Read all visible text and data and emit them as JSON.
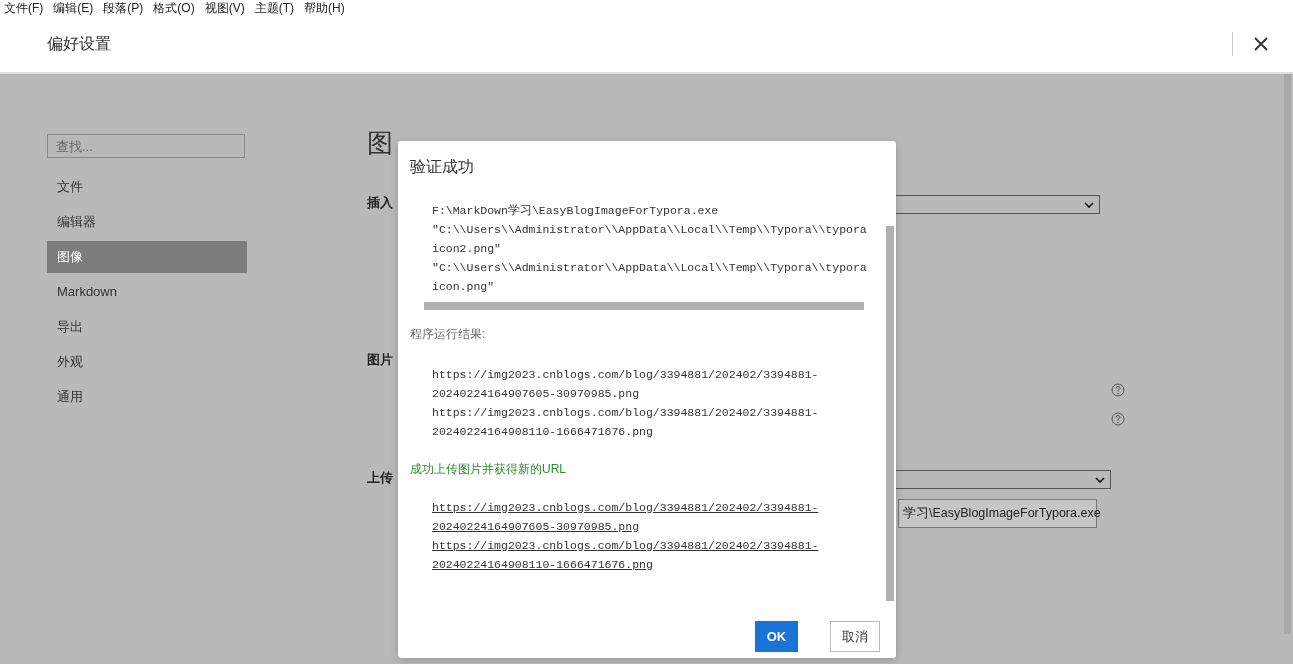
{
  "menu_bar": [
    "文件(F)",
    "编辑(E)",
    "段落(P)",
    "格式(O)",
    "视图(V)",
    "主题(T)",
    "帮助(H)"
  ],
  "window": {
    "title": "偏好设置"
  },
  "search": {
    "placeholder": "查找..."
  },
  "sidebar": {
    "items": [
      {
        "label": "文件",
        "selected": false
      },
      {
        "label": "编辑器",
        "selected": false
      },
      {
        "label": "图像",
        "selected": true
      },
      {
        "label": "Markdown",
        "selected": false
      },
      {
        "label": "导出",
        "selected": false
      },
      {
        "label": "外观",
        "selected": false
      },
      {
        "label": "通用",
        "selected": false
      }
    ]
  },
  "content": {
    "heading": "图",
    "section_labels": [
      "插入",
      "图片",
      "上传"
    ],
    "upload_command_button": "学习\\EasyBlogImageForTypora.exe"
  },
  "dialog": {
    "title": "验证成功",
    "command_lines": [
      "F:\\MarkDown学习\\EasyBlogImageForTypora.exe",
      "\"C:\\\\Users\\\\Administrator\\\\AppData\\\\Local\\\\Temp\\\\Typora\\\\typora",
      "icon2.png\"",
      "\"C:\\\\Users\\\\Administrator\\\\AppData\\\\Local\\\\Temp\\\\Typora\\\\typora",
      "icon.png\""
    ],
    "result_label": "程序运行结果:",
    "result_lines": [
      "https://img2023.cnblogs.com/blog/3394881/202402/3394881-",
      "20240224164907605-30970985.png",
      "https://img2023.cnblogs.com/blog/3394881/202402/3394881-",
      "20240224164908110-1666471676.png"
    ],
    "success_message": "成功上传图片并获得新的URL",
    "links": [
      "https://img2023.cnblogs.com/blog/3394881/202402/3394881-\n20240224164907605-30970985.png",
      "https://img2023.cnblogs.com/blog/3394881/202402/3394881-\n20240224164908110-1666471676.png"
    ],
    "buttons": [
      {
        "label": "OK",
        "kind": "primary"
      },
      {
        "label": "取消",
        "kind": "secondary"
      }
    ]
  }
}
